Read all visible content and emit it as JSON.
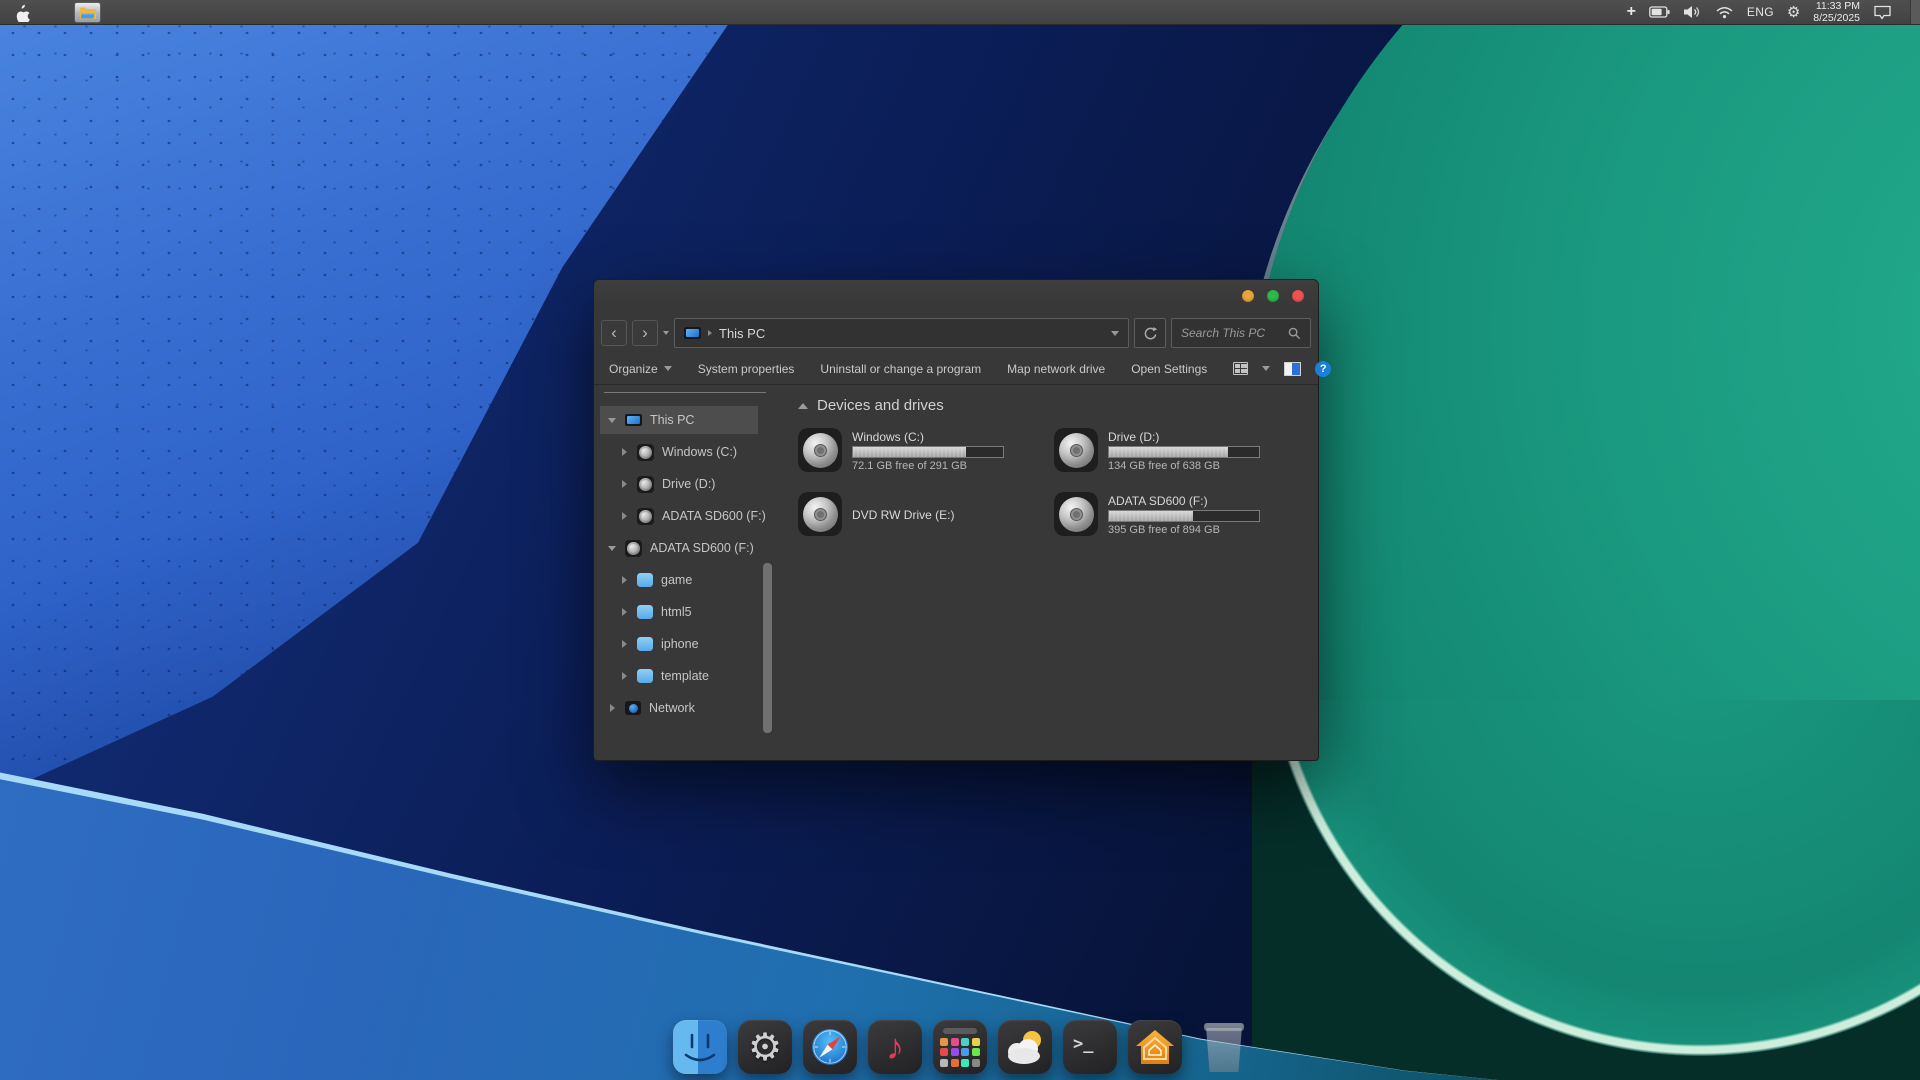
{
  "menubar": {
    "language": "ENG",
    "time": "11:33 PM",
    "date": "8/25/2025"
  },
  "window": {
    "address": "This PC",
    "search_placeholder": "Search This PC",
    "toolbar": {
      "organize": "Organize",
      "system_properties": "System properties",
      "uninstall": "Uninstall or change a program",
      "map_network": "Map network drive",
      "open_settings": "Open Settings"
    },
    "sidebar": {
      "items": [
        {
          "label": "This PC",
          "icon": "computer",
          "state": "expanded",
          "level": 0,
          "selected": true
        },
        {
          "label": "Windows (C:)",
          "icon": "disk",
          "state": "collapsed",
          "level": 1,
          "selected": false
        },
        {
          "label": "Drive (D:)",
          "icon": "disk",
          "state": "collapsed",
          "level": 1,
          "selected": false
        },
        {
          "label": "ADATA SD600 (F:)",
          "icon": "disk",
          "state": "collapsed",
          "level": 1,
          "selected": false
        },
        {
          "label": "ADATA SD600 (F:)",
          "icon": "disk",
          "state": "expanded",
          "level": 0,
          "selected": false
        },
        {
          "label": "game",
          "icon": "folder",
          "state": "collapsed",
          "level": 1,
          "selected": false
        },
        {
          "label": "html5",
          "icon": "folder",
          "state": "collapsed",
          "level": 1,
          "selected": false
        },
        {
          "label": "iphone",
          "icon": "folder",
          "state": "collapsed",
          "level": 1,
          "selected": false
        },
        {
          "label": "template",
          "icon": "folder",
          "state": "collapsed",
          "level": 1,
          "selected": false
        },
        {
          "label": "Network",
          "icon": "network",
          "state": "collapsed",
          "level": 0,
          "selected": false
        }
      ]
    },
    "content": {
      "section_title": "Devices and drives",
      "drives": [
        {
          "name": "Windows (C:)",
          "free_text": "72.1 GB free of 291 GB",
          "used_percent": 75
        },
        {
          "name": "Drive (D:)",
          "free_text": "134 GB free of 638 GB",
          "used_percent": 79
        },
        {
          "name": "DVD RW Drive (E:)",
          "free_text": "",
          "used_percent": 0
        },
        {
          "name": "ADATA SD600 (F:)",
          "free_text": "395 GB free of 894 GB",
          "used_percent": 56
        }
      ]
    }
  },
  "dock": {
    "items": [
      {
        "name": "finder"
      },
      {
        "name": "settings",
        "glyph": "⚙"
      },
      {
        "name": "safari"
      },
      {
        "name": "music",
        "glyph": "♪"
      },
      {
        "name": "launchpad"
      },
      {
        "name": "weather"
      },
      {
        "name": "terminal",
        "glyph": ">_"
      },
      {
        "name": "home"
      },
      {
        "name": "trash"
      }
    ]
  },
  "colors": {
    "accent_blue": "#1d7ed9",
    "traffic_yellow": "#e9a33b",
    "traffic_green": "#2db84c",
    "traffic_red": "#ed5351",
    "wallpaper_blue": "#2f63c8",
    "wallpaper_teal": "#1a9a80"
  }
}
